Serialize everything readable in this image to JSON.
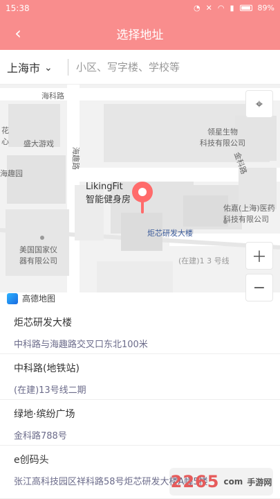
{
  "status": {
    "time": "15:38",
    "battery": "89%"
  },
  "header": {
    "title": "选择地址"
  },
  "search": {
    "city": "上海市",
    "placeholder": "小区、写字楼、学校等"
  },
  "map": {
    "labels": {
      "haike": "海科路",
      "huaxin_left": "花\n心",
      "shengda": "盛大游戏",
      "haiquyuan": "海趣园",
      "haiqu_road_v": "海趣路",
      "lingxing": "领星生物\n科技有限公司",
      "liking": "LikingFit\n智能健身房",
      "jucore": "炬芯研发大楼",
      "youjia": "佑嘉(上海)医药\n科技有限公司",
      "meiguo": "美国国家仪\n器有限公司",
      "line13": "(在建)1 3 号线",
      "jinke": "金科路",
      "brand": "高德地图"
    }
  },
  "results": [
    {
      "name": "炬芯研发大楼",
      "address": "中科路与海趣路交叉口东北100米"
    },
    {
      "name": "中科路(地铁站)",
      "address": "(在建)13号线二期"
    },
    {
      "name": "绿地·缤纷广场",
      "address": "金科路788号"
    },
    {
      "name": "e创码头",
      "address": "张江高科技园区祥科路58号炬芯研发大楼A幢5楼"
    }
  ],
  "watermark": {
    "number": "2265",
    "suffix": "com",
    "cn": "手游网"
  },
  "colors": {
    "header_bg": "#f98d8d",
    "pin": "#ff6b6b",
    "address_text": "#6b6b8a"
  },
  "icons": {
    "back": "back-icon",
    "dropdown": "chevron-down-icon",
    "gps": "locate-icon",
    "zoom_in": "plus-icon",
    "zoom_out": "minus-icon"
  }
}
